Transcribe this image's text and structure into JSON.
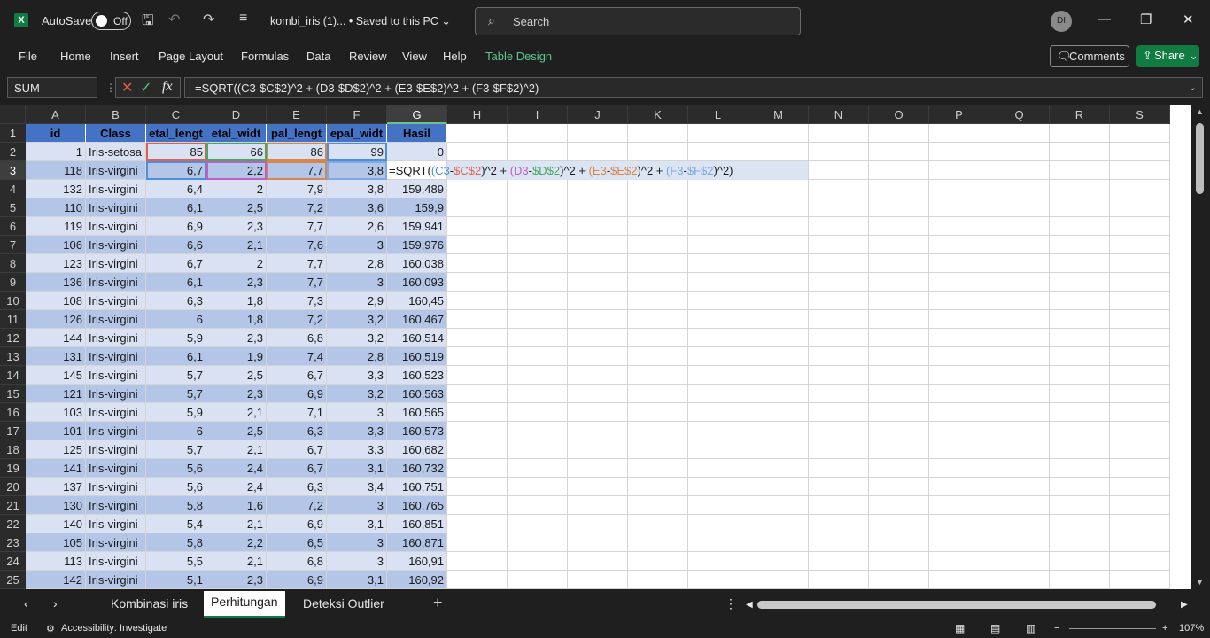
{
  "titlebar": {
    "logo": "X",
    "autosave_label": "AutoSave",
    "toggle_label": "Off",
    "filename": "kombi_iris (1)... • Saved to this PC ⌄",
    "search_placeholder": "Search",
    "avatar": "DI",
    "icons": [
      "save-icon",
      "undo-icon",
      "redo-icon",
      "customize-icon",
      "minimize-icon",
      "restore-icon",
      "close-icon"
    ]
  },
  "ribbon": {
    "tabs": [
      "File",
      "Home",
      "Insert",
      "Page Layout",
      "Formulas",
      "Data",
      "Review",
      "View",
      "Help",
      "Table Design"
    ],
    "comments_label": "Comments",
    "share_label": "Share"
  },
  "formula_bar": {
    "name_box": "SUM",
    "formula": "=SQRT((C3-$C$2)^2 + (D3-$D$2)^2 + (E3-$E$2)^2 + (F3-$F$2)^2)"
  },
  "grid": {
    "columns": [
      "A",
      "B",
      "C",
      "D",
      "E",
      "F",
      "G",
      "H",
      "I",
      "J",
      "K",
      "L",
      "M",
      "N",
      "O",
      "P",
      "Q",
      "R",
      "S"
    ],
    "selected_column": "G",
    "selected_row": "3",
    "header_row": [
      "id",
      "Class",
      "etal_lengt",
      "etal_widt",
      "pal_lengt",
      "epal_widt",
      "Hasil"
    ],
    "rows": [
      {
        "n": "1"
      },
      {
        "n": "2",
        "id": "1",
        "cls": "Iris-setosa",
        "c": "85",
        "d": "66",
        "e": "86",
        "f": "99",
        "g": "0"
      },
      {
        "n": "3",
        "id": "118",
        "cls": "Iris-virgini",
        "c": "6,7",
        "d": "2,2",
        "e": "7,7",
        "f": "3,8",
        "g": ""
      },
      {
        "n": "4",
        "id": "132",
        "cls": "Iris-virgini",
        "c": "6,4",
        "d": "2",
        "e": "7,9",
        "f": "3,8",
        "g": "159,489"
      },
      {
        "n": "5",
        "id": "110",
        "cls": "Iris-virgini",
        "c": "6,1",
        "d": "2,5",
        "e": "7,2",
        "f": "3,6",
        "g": "159,9"
      },
      {
        "n": "6",
        "id": "119",
        "cls": "Iris-virgini",
        "c": "6,9",
        "d": "2,3",
        "e": "7,7",
        "f": "2,6",
        "g": "159,941"
      },
      {
        "n": "7",
        "id": "106",
        "cls": "Iris-virgini",
        "c": "6,6",
        "d": "2,1",
        "e": "7,6",
        "f": "3",
        "g": "159,976"
      },
      {
        "n": "8",
        "id": "123",
        "cls": "Iris-virgini",
        "c": "6,7",
        "d": "2",
        "e": "7,7",
        "f": "2,8",
        "g": "160,038"
      },
      {
        "n": "9",
        "id": "136",
        "cls": "Iris-virgini",
        "c": "6,1",
        "d": "2,3",
        "e": "7,7",
        "f": "3",
        "g": "160,093"
      },
      {
        "n": "10",
        "id": "108",
        "cls": "Iris-virgini",
        "c": "6,3",
        "d": "1,8",
        "e": "7,3",
        "f": "2,9",
        "g": "160,45"
      },
      {
        "n": "11",
        "id": "126",
        "cls": "Iris-virgini",
        "c": "6",
        "d": "1,8",
        "e": "7,2",
        "f": "3,2",
        "g": "160,467"
      },
      {
        "n": "12",
        "id": "144",
        "cls": "Iris-virgini",
        "c": "5,9",
        "d": "2,3",
        "e": "6,8",
        "f": "3,2",
        "g": "160,514"
      },
      {
        "n": "13",
        "id": "131",
        "cls": "Iris-virgini",
        "c": "6,1",
        "d": "1,9",
        "e": "7,4",
        "f": "2,8",
        "g": "160,519"
      },
      {
        "n": "14",
        "id": "145",
        "cls": "Iris-virgini",
        "c": "5,7",
        "d": "2,5",
        "e": "6,7",
        "f": "3,3",
        "g": "160,523"
      },
      {
        "n": "15",
        "id": "121",
        "cls": "Iris-virgini",
        "c": "5,7",
        "d": "2,3",
        "e": "6,9",
        "f": "3,2",
        "g": "160,563"
      },
      {
        "n": "16",
        "id": "103",
        "cls": "Iris-virgini",
        "c": "5,9",
        "d": "2,1",
        "e": "7,1",
        "f": "3",
        "g": "160,565"
      },
      {
        "n": "17",
        "id": "101",
        "cls": "Iris-virgini",
        "c": "6",
        "d": "2,5",
        "e": "6,3",
        "f": "3,3",
        "g": "160,573"
      },
      {
        "n": "18",
        "id": "125",
        "cls": "Iris-virgini",
        "c": "5,7",
        "d": "2,1",
        "e": "6,7",
        "f": "3,3",
        "g": "160,682"
      },
      {
        "n": "19",
        "id": "141",
        "cls": "Iris-virgini",
        "c": "5,6",
        "d": "2,4",
        "e": "6,7",
        "f": "3,1",
        "g": "160,732"
      },
      {
        "n": "20",
        "id": "137",
        "cls": "Iris-virgini",
        "c": "5,6",
        "d": "2,4",
        "e": "6,3",
        "f": "3,4",
        "g": "160,751"
      },
      {
        "n": "21",
        "id": "130",
        "cls": "Iris-virgini",
        "c": "5,8",
        "d": "1,6",
        "e": "7,2",
        "f": "3",
        "g": "160,765"
      },
      {
        "n": "22",
        "id": "140",
        "cls": "Iris-virgini",
        "c": "5,4",
        "d": "2,1",
        "e": "6,9",
        "f": "3,1",
        "g": "160,851"
      },
      {
        "n": "23",
        "id": "105",
        "cls": "Iris-virgini",
        "c": "5,8",
        "d": "2,2",
        "e": "6,5",
        "f": "3",
        "g": "160,871"
      },
      {
        "n": "24",
        "id": "113",
        "cls": "Iris-virgini",
        "c": "5,5",
        "d": "2,1",
        "e": "6,8",
        "f": "3",
        "g": "160,91"
      },
      {
        "n": "25",
        "id": "142",
        "cls": "Iris-virgini",
        "c": "5,1",
        "d": "2,3",
        "e": "6,9",
        "f": "3,1",
        "g": "160,92"
      }
    ],
    "edit_cell_parts": [
      {
        "t": "=SQRT(",
        "c": "plain"
      },
      {
        "t": "(",
        "c": "ref1"
      },
      {
        "t": "C3",
        "c": "ref1"
      },
      {
        "t": "-",
        "c": "plain"
      },
      {
        "t": "$C$2",
        "c": "refR"
      },
      {
        "t": ")^2 + ",
        "c": "plain"
      },
      {
        "t": "(",
        "c": "ref2"
      },
      {
        "t": "D3",
        "c": "ref2"
      },
      {
        "t": "-",
        "c": "plain"
      },
      {
        "t": "$D$2",
        "c": "refD"
      },
      {
        "t": ")^2 + ",
        "c": "plain"
      },
      {
        "t": "(",
        "c": "ref3"
      },
      {
        "t": "E3",
        "c": "ref3"
      },
      {
        "t": "-",
        "c": "plain"
      },
      {
        "t": "$E$2",
        "c": "ref3"
      },
      {
        "t": ")^2 + ",
        "c": "plain"
      },
      {
        "t": "(",
        "c": "ref4"
      },
      {
        "t": "F3",
        "c": "ref4"
      },
      {
        "t": "-",
        "c": "plain"
      },
      {
        "t": "$F$2",
        "c": "ref4"
      },
      {
        "t": ")^2)",
        "c": "plain"
      }
    ]
  },
  "sheets": {
    "tabs": [
      "Kombinasi iris",
      "Perhitungan",
      "Deteksi Outlier"
    ],
    "active": "Perhitungan"
  },
  "status": {
    "mode": "Edit",
    "accessibility": "Accessibility: Investigate",
    "zoom": "107%"
  }
}
